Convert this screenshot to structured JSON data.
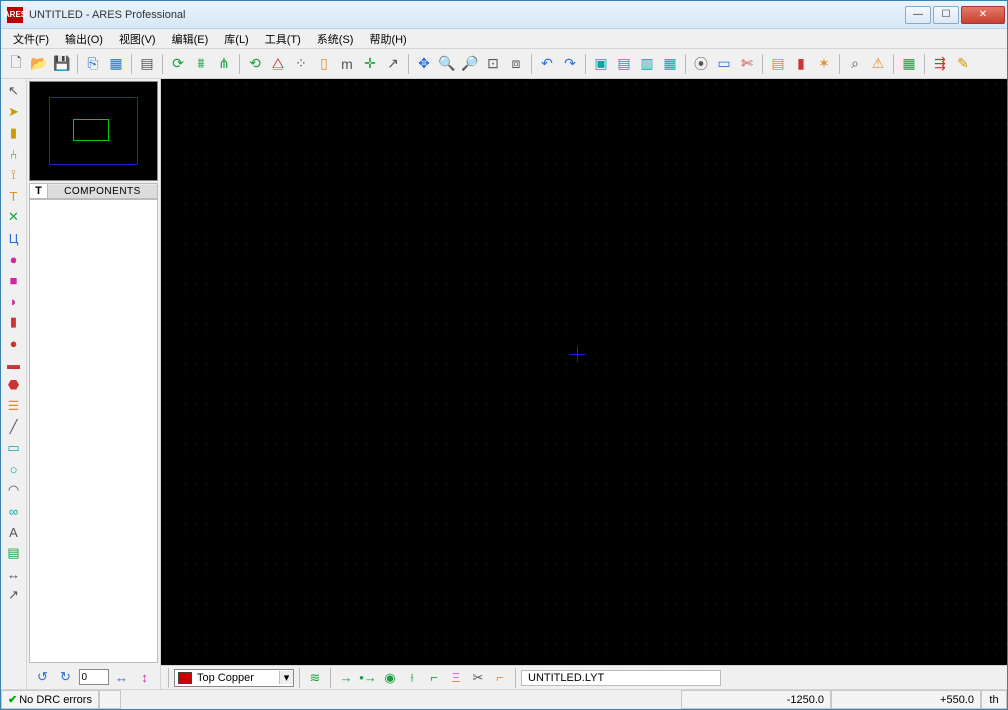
{
  "title": "UNTITLED - ARES Professional",
  "app_icon": "ARES",
  "menus": [
    "文件(F)",
    "输出(O)",
    "视图(V)",
    "编辑(E)",
    "库(L)",
    "工具(T)",
    "系统(S)",
    "帮助(H)"
  ],
  "toolbar_icons": [
    {
      "n": "new-file-icon",
      "g": "🗋",
      "c": "c-gray"
    },
    {
      "n": "open-file-icon",
      "g": "📂",
      "c": "c-yellow"
    },
    {
      "n": "save-file-icon",
      "g": "💾",
      "c": "c-blue"
    },
    {
      "sep": true
    },
    {
      "n": "import-icon",
      "g": "⎘",
      "c": "c-blue"
    },
    {
      "n": "area-icon",
      "g": "▦",
      "c": "c-blue"
    },
    {
      "sep": true
    },
    {
      "n": "print-icon",
      "g": "▤",
      "c": "c-gray"
    },
    {
      "sep": true
    },
    {
      "n": "zone-refresh-icon",
      "g": "⟳",
      "c": "c-green"
    },
    {
      "n": "filter-icon",
      "g": "⩩",
      "c": "c-green"
    },
    {
      "n": "net-icon",
      "g": "⋔",
      "c": "c-green"
    },
    {
      "sep": true
    },
    {
      "n": "redraw-icon",
      "g": "⟲",
      "c": "c-green"
    },
    {
      "n": "flip-icon",
      "g": "⧋",
      "c": "c-red"
    },
    {
      "n": "grid-dots-icon",
      "g": "⁘",
      "c": "c-gray"
    },
    {
      "n": "layers-icon",
      "g": "▯",
      "c": "c-orange"
    },
    {
      "n": "metric-icon",
      "g": "m",
      "c": "c-gray"
    },
    {
      "n": "origin-icon",
      "g": "✛",
      "c": "c-green"
    },
    {
      "n": "cursor-origin-icon",
      "g": "↗",
      "c": "c-gray"
    },
    {
      "sep": true
    },
    {
      "n": "pan-icon",
      "g": "✥",
      "c": "c-blue"
    },
    {
      "n": "zoom-in-icon",
      "g": "🔍",
      "c": "c-gray"
    },
    {
      "n": "zoom-out-icon",
      "g": "🔎",
      "c": "c-gray"
    },
    {
      "n": "zoom-all-icon",
      "g": "⊡",
      "c": "c-gray"
    },
    {
      "n": "zoom-area-icon",
      "g": "⧈",
      "c": "c-gray"
    },
    {
      "sep": true
    },
    {
      "n": "undo-icon",
      "g": "↶",
      "c": "c-blue"
    },
    {
      "n": "redo-icon",
      "g": "↷",
      "c": "c-blue"
    },
    {
      "sep": true
    },
    {
      "n": "block-copy-icon",
      "g": "▣",
      "c": "c-cyan"
    },
    {
      "n": "block-move-icon",
      "g": "▤",
      "c": "c-cyan"
    },
    {
      "n": "block-rotate-icon",
      "g": "▥",
      "c": "c-cyan"
    },
    {
      "n": "block-delete-icon",
      "g": "▦",
      "c": "c-cyan"
    },
    {
      "sep": true
    },
    {
      "n": "pick-icon",
      "g": "⦿",
      "c": "c-gray"
    },
    {
      "n": "make-pkg-icon",
      "g": "▭",
      "c": "c-blue"
    },
    {
      "n": "decompose-icon",
      "g": "✄",
      "c": "c-red"
    },
    {
      "sep": true
    },
    {
      "n": "toggle-x-icon",
      "g": "▤",
      "c": "c-orange"
    },
    {
      "n": "highlight-icon",
      "g": "▮",
      "c": "c-red"
    },
    {
      "n": "connectivity-icon",
      "g": "✶",
      "c": "c-orange"
    },
    {
      "sep": true
    },
    {
      "n": "search-icon",
      "g": "⌕",
      "c": "c-gray"
    },
    {
      "n": "drc-icon",
      "g": "⚠",
      "c": "c-orange"
    },
    {
      "sep": true
    },
    {
      "n": "autoplace-icon",
      "g": "▦",
      "c": "c-green"
    },
    {
      "sep": true
    },
    {
      "n": "autoroute-icon",
      "g": "⇶",
      "c": "c-red"
    },
    {
      "n": "route-edit-icon",
      "g": "✎",
      "c": "c-yellow"
    }
  ],
  "left_tools": [
    {
      "n": "select-tool-icon",
      "g": "↖",
      "c": "c-gray"
    },
    {
      "n": "component-tool-icon",
      "g": "➤",
      "c": "c-yellow"
    },
    {
      "n": "package-tool-icon",
      "g": "▮",
      "c": "c-yellow"
    },
    {
      "n": "track-tool-icon",
      "g": "⑃",
      "c": "c-green"
    },
    {
      "n": "via-tool-icon",
      "g": "⟟",
      "c": "c-orange"
    },
    {
      "n": "zone-tool-icon",
      "g": "T",
      "c": "c-orange"
    },
    {
      "n": "ratsnest-tool-icon",
      "g": "✕",
      "c": "c-green"
    },
    {
      "n": "conn-hilite-tool-icon",
      "g": "Ц",
      "c": "c-blue"
    },
    {
      "n": "pad-round-tool-icon",
      "g": "●",
      "c": "c-pink"
    },
    {
      "n": "pad-square-tool-icon",
      "g": "■",
      "c": "c-pink"
    },
    {
      "n": "pad-dshape-tool-icon",
      "g": "◗",
      "c": "c-pink"
    },
    {
      "n": "pad-edge-tool-icon",
      "g": "▮",
      "c": "c-red"
    },
    {
      "n": "smd-round-tool-icon",
      "g": "●",
      "c": "c-red"
    },
    {
      "n": "smd-rect-tool-icon",
      "g": "▬",
      "c": "c-red"
    },
    {
      "n": "smd-poly-tool-icon",
      "g": "⬣",
      "c": "c-red"
    },
    {
      "n": "padstack-tool-icon",
      "g": "☰",
      "c": "c-orange"
    },
    {
      "n": "line-tool-icon",
      "g": "╱",
      "c": "c-gray"
    },
    {
      "n": "box-tool-icon",
      "g": "▭",
      "c": "c-cyan"
    },
    {
      "n": "circle-tool-icon",
      "g": "○",
      "c": "c-cyan"
    },
    {
      "n": "arc-tool-icon",
      "g": "◠",
      "c": "c-gray"
    },
    {
      "n": "path-tool-icon",
      "g": "∞",
      "c": "c-cyan"
    },
    {
      "n": "text-tool-icon",
      "g": "A",
      "c": "c-gray"
    },
    {
      "n": "symbol-tool-icon",
      "g": "▤",
      "c": "c-green"
    },
    {
      "n": "dimension-tool-icon",
      "g": "↔",
      "c": "c-gray"
    },
    {
      "n": "marker-tool-icon",
      "g": "↗",
      "c": "c-gray"
    }
  ],
  "components_header": {
    "tab": "T",
    "label": "COMPONENTS"
  },
  "side_nav_icons": [
    {
      "n": "rotate-ccw-icon",
      "g": "↺",
      "c": "c-blue"
    },
    {
      "n": "rotate-cw-icon",
      "g": "↻",
      "c": "c-blue"
    },
    {
      "n": "angle-value",
      "g": "0"
    },
    {
      "n": "mirror-x-icon",
      "g": "↔",
      "c": "c-blue"
    },
    {
      "n": "mirror-y-icon",
      "g": "↕",
      "c": "c-pink"
    }
  ],
  "bottom": {
    "layer_name": "Top Copper",
    "icons": [
      {
        "n": "layer-stack-icon",
        "g": "≋",
        "c": "c-green"
      },
      {
        "sep": true
      },
      {
        "n": "ratsnest-toggle-icon",
        "g": "→",
        "c": "c-green"
      },
      {
        "n": "force-vector-icon",
        "g": "•→",
        "c": "c-green"
      },
      {
        "n": "world-icon",
        "g": "◉",
        "c": "c-green"
      },
      {
        "n": "trace-style-icon",
        "g": "⟊",
        "c": "c-green"
      },
      {
        "n": "trace-angle-icon",
        "g": "⌐",
        "c": "c-green"
      },
      {
        "n": "auto-trace-neck-icon",
        "g": "Ξ",
        "c": "c-orange"
      },
      {
        "n": "auto-track-icon",
        "g": "✂",
        "c": "c-gray"
      },
      {
        "n": "route-corner-icon",
        "g": "⌐",
        "c": "c-orange"
      }
    ],
    "filename": "UNTITLED.LYT"
  },
  "status": {
    "drc": "No DRC errors",
    "x": "-1250.0",
    "y": "+550.0",
    "unit": "th"
  }
}
